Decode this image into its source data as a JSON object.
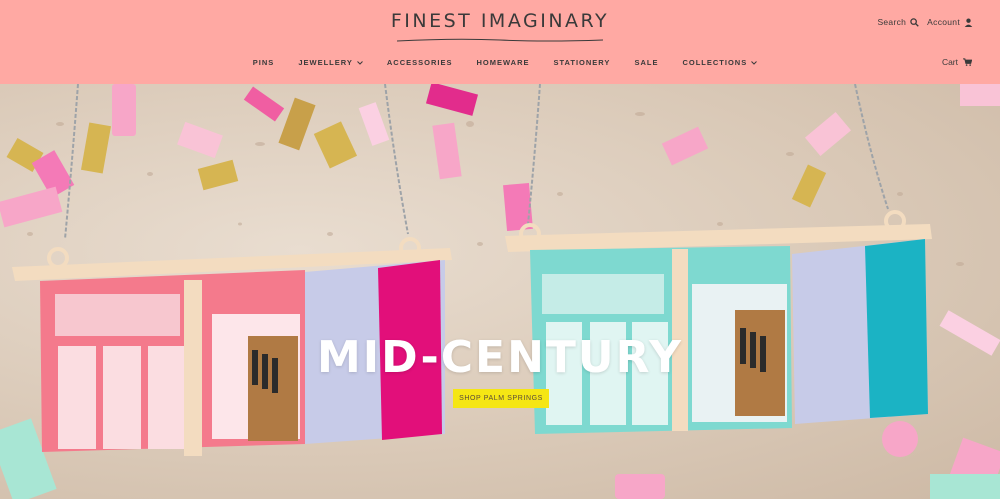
{
  "brand": {
    "name": "FINEST IMAGINARY"
  },
  "utility": {
    "search_label": "Search",
    "account_label": "Account"
  },
  "nav": {
    "items": [
      {
        "label": "PINS",
        "dropdown": false
      },
      {
        "label": "JEWELLERY",
        "dropdown": true
      },
      {
        "label": "ACCESSORIES",
        "dropdown": false
      },
      {
        "label": "HOMEWARE",
        "dropdown": false
      },
      {
        "label": "STATIONERY",
        "dropdown": false
      },
      {
        "label": "SALE",
        "dropdown": false
      },
      {
        "label": "COLLECTIONS",
        "dropdown": true
      }
    ]
  },
  "cart": {
    "label": "Cart"
  },
  "hero": {
    "title": "MID-CENTURY",
    "button_label": "SHOP PALM SPRINGS"
  },
  "colors": {
    "header_bg": "#ffa9a3",
    "button_bg": "#f5e614",
    "text_dark": "#3a3a3a"
  },
  "icons": {
    "search": "search-icon",
    "account": "user-icon",
    "cart": "cart-icon",
    "dropdown": "chevron-down-icon"
  }
}
